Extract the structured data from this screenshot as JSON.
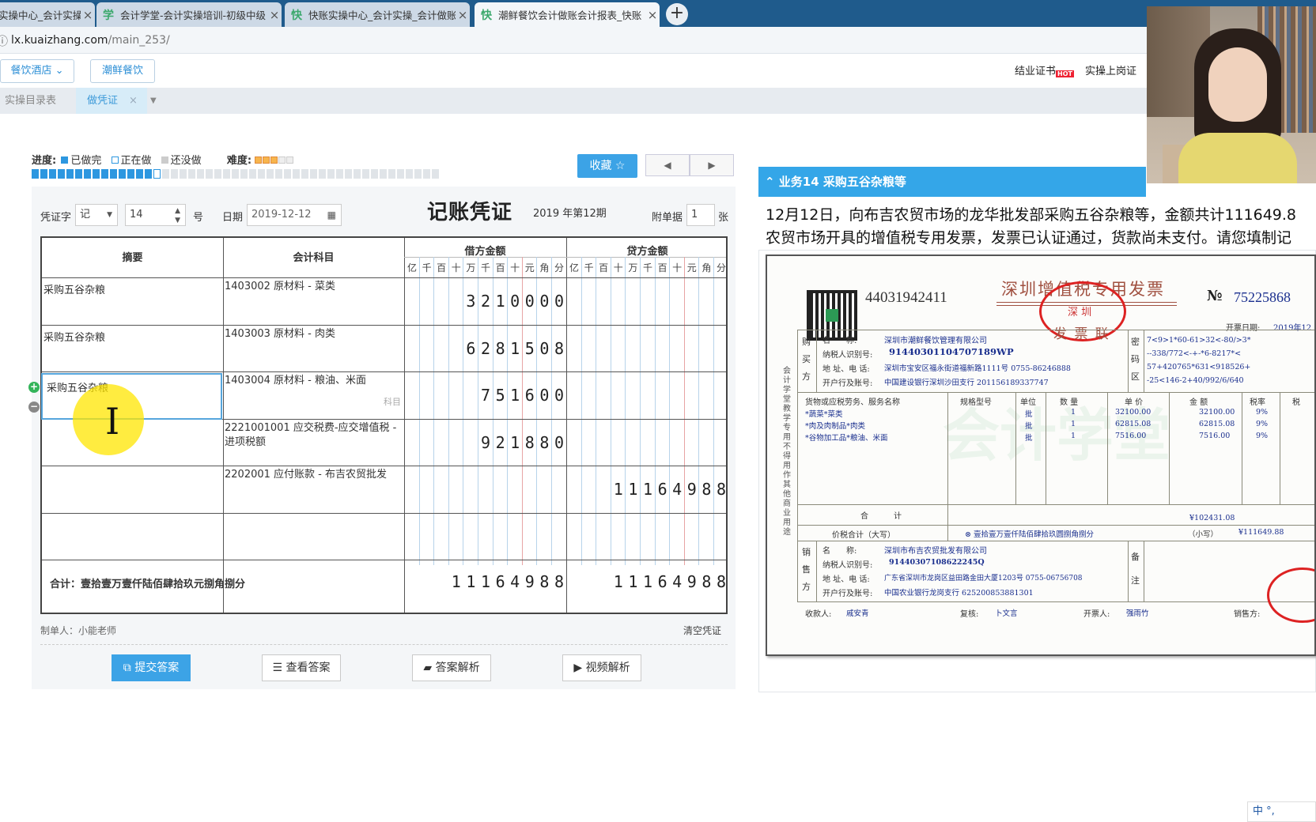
{
  "browser": {
    "tabs": [
      {
        "icon": "",
        "title": "实操中心_会计实操",
        "active": false
      },
      {
        "icon": "学",
        "title": "会计学堂-会计实操培训-初级中级",
        "active": false
      },
      {
        "icon": "快",
        "title": "快账实操中心_会计实操_会计做账",
        "active": false
      },
      {
        "icon": "快",
        "title": "潮鲜餐饮会计做账会计报表_快账",
        "active": true
      }
    ],
    "new_tab": "+",
    "url_host": "lx.kuaizhang.com",
    "url_path": "/main_253/"
  },
  "header": {
    "industry_select": "餐饮酒店",
    "company_button": "潮鲜餐饮",
    "certificate_link": "结业证书",
    "job_cert_link": "实操上岗证",
    "hot_badge": "HOT"
  },
  "subtabs": {
    "catalog": "实操目录表",
    "voucher": "做凭证"
  },
  "progress": {
    "label": "进度:",
    "done": "已做完",
    "doing": "正在做",
    "todo": "还没做",
    "difficulty_label": "难度:",
    "difficulty_stars": 3,
    "difficulty_max": 5,
    "done_count": 14,
    "total_count": 47,
    "favorite_button": "收藏 ☆"
  },
  "voucher": {
    "word_label": "凭证字",
    "word_value": "记",
    "number_value": "14",
    "number_suffix": "号",
    "date_label": "日期",
    "date_value": "2019-12-12",
    "title": "记账凭证",
    "period": "2019 年第12期",
    "attach_label": "附单据",
    "attach_value": "1",
    "attach_suffix": "张",
    "col_summary": "摘要",
    "col_subject": "会计科目",
    "col_debit": "借方金额",
    "col_credit": "贷方金额",
    "units": [
      "亿",
      "千",
      "百",
      "十",
      "万",
      "千",
      "百",
      "十",
      "元",
      "角",
      "分"
    ],
    "subject_hint": "科目",
    "rows": [
      {
        "summary": "采购五谷杂粮",
        "subject": "1403002 原材料 - 菜类",
        "debit": "3210000",
        "credit": ""
      },
      {
        "summary": "采购五谷杂粮",
        "subject": "1403003 原材料 - 肉类",
        "debit": "6281508",
        "credit": ""
      },
      {
        "summary": "采购五谷杂粮",
        "subject": "1403004 原材料 - 粮油、米面",
        "debit": "751600",
        "credit": ""
      },
      {
        "summary": "",
        "subject": "2221001001 应交税费-应交增值税 - 进项税额",
        "debit": "921880",
        "credit": ""
      },
      {
        "summary": "",
        "subject": "2202001 应付账款 - 布吉农贸批发",
        "debit": "",
        "credit": "11164988"
      },
      {
        "summary": "",
        "subject": "",
        "debit": "",
        "credit": ""
      }
    ],
    "total_label": "合计：壹拾壹万壹仟陆佰肆拾玖元捌角捌分",
    "total_debit": "11164988",
    "total_credit": "11164988",
    "maker": "制单人：小能老师",
    "clear": "清空凭证",
    "buttons": {
      "submit": "提交答案",
      "view": "查看答案",
      "analysis": "答案解析",
      "video": "视频解析"
    }
  },
  "business": {
    "title": "业务14 采购五谷杂粮等",
    "text_line1": "12月12日，向布吉农贸市场的龙华批发部采购五谷杂粮等，金额共计111649.8",
    "text_line2": "农贸市场开具的增值税专用发票，发票已认证通过，货款尚未支付。请您填制记"
  },
  "invoice": {
    "code": "44031942411",
    "title": "深圳增值税专用发票",
    "no_label": "№",
    "no": "75225868",
    "date_label": "开票日期:",
    "date": "2019年12",
    "seal_text": "深 圳",
    "copy_label": "发 票 联",
    "side_label": "会计学堂教学专用 不得用作其他商业用途",
    "buyer_section": "购买方",
    "seller_section": "销售方",
    "cipher_label": "密码区",
    "name_label": "名　　称:",
    "taxid_label": "纳税人识别号:",
    "addr_label": "地 址、电 话:",
    "bank_label": "开户行及账号:",
    "buyer": {
      "name": "深圳市潮鲜餐饮管理有限公司",
      "taxid": "91440301104707189WP",
      "addr": "深圳市宝安区福永街道福新路1111号 0755-86246888",
      "bank": "中国建设银行深圳沙田支行 201156189337747"
    },
    "cipher": [
      "7<9>1*60-61>32<-80/>3*",
      "--338/772<-+-*6-8217*<",
      "57+420765*631<918526+",
      "-25<146-2+40/992/6/640"
    ],
    "headers": {
      "item": "货物或应税劳务、服务名称",
      "spec": "规格型号",
      "unit": "单位",
      "qty": "数 量",
      "price": "单 价",
      "amount": "金 额",
      "rate": "税率",
      "tax": "税"
    },
    "items": [
      {
        "name": "*蔬菜*菜类",
        "unit": "批",
        "qty": "1",
        "price": "32100.00",
        "amount": "32100.00",
        "rate": "9%"
      },
      {
        "name": "*肉及肉制品*肉类",
        "unit": "批",
        "qty": "1",
        "price": "62815.08",
        "amount": "62815.08",
        "rate": "9%"
      },
      {
        "name": "*谷物加工品*粮油、米面",
        "unit": "批",
        "qty": "1",
        "price": "7516.00",
        "amount": "7516.00",
        "rate": "9%"
      }
    ],
    "total_label": "合　　计",
    "total_amount": "¥102431.08",
    "tax_total_label": "价税合计（大写）",
    "tax_total_words": "⊗ 壹拾壹万壹仟陆佰肆拾玖圆捌角捌分",
    "small_label": "（小写）",
    "small_amount": "¥111649.88",
    "seller": {
      "name": "深圳市布吉农贸批发有限公司",
      "taxid": "91440307108622245Q",
      "addr": "广东省深圳市龙岗区益田路金田大厦1203号 0755-06756708",
      "bank": "中国农业银行龙岗支行 625200853881301"
    },
    "remark_label": "备注",
    "payee_label": "收款人:",
    "payee": "戚安青",
    "review_label": "复核:",
    "review": "卜文言",
    "drawer_label": "开票人:",
    "drawer": "强雨竹",
    "seller_sign_label": "销售方:",
    "watermark": "会计学堂"
  },
  "ime": "中 °,"
}
